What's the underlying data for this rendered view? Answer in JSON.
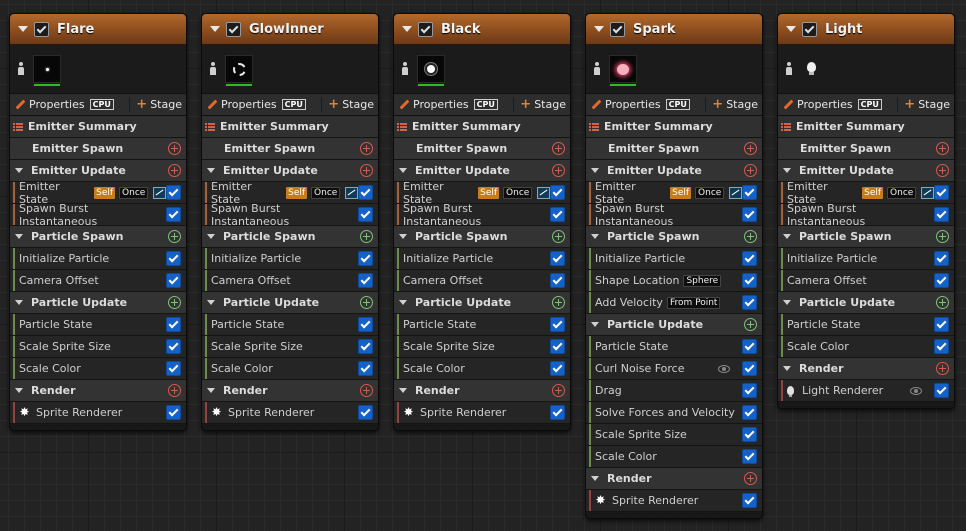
{
  "labels": {
    "properties": "Properties",
    "cpu": "CPU",
    "stage": "Stage",
    "emitter_summary": "Emitter Summary",
    "emitter_spawn": "Emitter Spawn",
    "emitter_update": "Emitter Update",
    "particle_spawn": "Particle Spawn",
    "particle_update": "Particle Update",
    "render": "Render"
  },
  "colors": {
    "header_accent": "#b3692c",
    "checkbox": "#1561c7",
    "add_red": "#d9594c",
    "add_green": "#7ec27a",
    "preview_bar": "#2bbd1c"
  },
  "emitters": [
    {
      "name": "Flare",
      "thumbnail": "flare-point",
      "emitter_update": [
        {
          "label": "Emitter State",
          "badges": [
            "Self",
            "Once"
          ],
          "curve_icon": true
        },
        {
          "label": "Spawn Burst Instantaneous"
        }
      ],
      "particle_spawn": [
        {
          "label": "Initialize Particle"
        },
        {
          "label": "Camera Offset"
        }
      ],
      "particle_update": [
        {
          "label": "Particle State"
        },
        {
          "label": "Scale Sprite Size"
        },
        {
          "label": "Scale Color"
        }
      ],
      "render": [
        {
          "label": "Sprite Renderer",
          "icon": "sprite-icon"
        }
      ]
    },
    {
      "name": "GlowInner",
      "thumbnail": "glow-ring",
      "emitter_update": [
        {
          "label": "Emitter State",
          "badges": [
            "Self",
            "Once"
          ],
          "curve_icon": true
        },
        {
          "label": "Spawn Burst Instantaneous"
        }
      ],
      "particle_spawn": [
        {
          "label": "Initialize Particle"
        },
        {
          "label": "Camera Offset"
        }
      ],
      "particle_update": [
        {
          "label": "Particle State"
        },
        {
          "label": "Scale Sprite Size"
        },
        {
          "label": "Scale Color"
        }
      ],
      "render": [
        {
          "label": "Sprite Renderer",
          "icon": "sprite-icon"
        }
      ]
    },
    {
      "name": "Black",
      "thumbnail": "black-dot",
      "emitter_update": [
        {
          "label": "Emitter State",
          "badges": [
            "Self",
            "Once"
          ],
          "curve_icon": true
        },
        {
          "label": "Spawn Burst Instantaneous"
        }
      ],
      "particle_spawn": [
        {
          "label": "Initialize Particle"
        },
        {
          "label": "Camera Offset"
        }
      ],
      "particle_update": [
        {
          "label": "Particle State"
        },
        {
          "label": "Scale Sprite Size"
        },
        {
          "label": "Scale Color"
        }
      ],
      "render": [
        {
          "label": "Sprite Renderer",
          "icon": "sprite-icon"
        }
      ]
    },
    {
      "name": "Spark",
      "thumbnail": "spark-glow",
      "emitter_update": [
        {
          "label": "Emitter State",
          "badges": [
            "Self",
            "Once"
          ],
          "curve_icon": true
        },
        {
          "label": "Spawn Burst Instantaneous"
        }
      ],
      "particle_spawn": [
        {
          "label": "Initialize Particle"
        },
        {
          "label": "Shape Location",
          "badges": [
            "Sphere"
          ]
        },
        {
          "label": "Add Velocity",
          "badges": [
            "From Point"
          ]
        }
      ],
      "particle_update": [
        {
          "label": "Particle State"
        },
        {
          "label": "Curl Noise Force",
          "eye": true
        },
        {
          "label": "Drag"
        },
        {
          "label": "Solve Forces and Velocity"
        },
        {
          "label": "Scale Sprite Size"
        },
        {
          "label": "Scale Color"
        }
      ],
      "render": [
        {
          "label": "Sprite Renderer",
          "icon": "sprite-icon"
        }
      ]
    },
    {
      "name": "Light",
      "thumbnail": "light-bulb",
      "emitter_update": [
        {
          "label": "Emitter State",
          "badges": [
            "Self",
            "Once"
          ],
          "curve_icon": true
        },
        {
          "label": "Spawn Burst Instantaneous"
        }
      ],
      "particle_spawn": [
        {
          "label": "Initialize Particle"
        },
        {
          "label": "Camera Offset"
        }
      ],
      "particle_update": [
        {
          "label": "Particle State"
        },
        {
          "label": "Scale Color"
        }
      ],
      "render": [
        {
          "label": "Light Renderer",
          "icon": "light-bulb-icon",
          "eye": true
        }
      ]
    }
  ]
}
